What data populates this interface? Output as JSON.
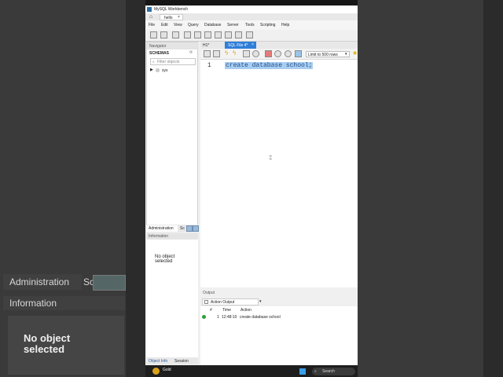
{
  "background": {
    "admin_tab": "Administration",
    "sc_tab": "Sc",
    "info_tab": "Information",
    "no_object": "No object selected"
  },
  "window": {
    "title": "MySQL Workbench",
    "connection_tab": "hello",
    "menu": [
      "File",
      "Edit",
      "View",
      "Query",
      "Database",
      "Server",
      "Tools",
      "Scripting",
      "Help"
    ]
  },
  "navigator": {
    "header": "Navigator",
    "schemas_label": "SCHEMAS",
    "filter_placeholder": "Filter objects",
    "schema_items": [
      "sys"
    ]
  },
  "admin_tabs": {
    "admin": "Administration",
    "sc": "Sc"
  },
  "information": {
    "header": "Information",
    "no_object": "No object selected"
  },
  "object_tabs": {
    "object_info": "Object Info",
    "session": "Session"
  },
  "editor": {
    "tabs": [
      "H1*",
      "SQL File 4*"
    ],
    "limit_label": "Limit to 500 rows",
    "line_number": "1",
    "sql": "create database school;"
  },
  "output": {
    "header": "Output",
    "selector": "Action Output",
    "columns": [
      "#",
      "Time",
      "Action"
    ],
    "rows": [
      {
        "num": "1",
        "time": "12:48:10",
        "action": "create database school"
      }
    ]
  },
  "taskbar": {
    "weather": "Gold",
    "search": "Search"
  },
  "colors": {
    "accent": "#2f7ed8",
    "selection": "#a8cdf0",
    "success": "#2e9e3a"
  }
}
